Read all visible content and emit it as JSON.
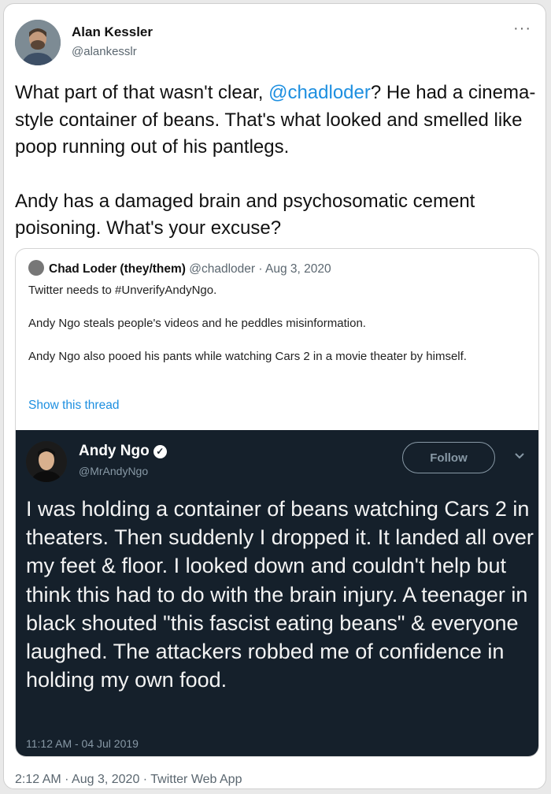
{
  "tweet": {
    "author_name": "Alan Kessler",
    "author_handle": "@alankesslr",
    "more_icon": "more-horizontal-icon",
    "text_part1": "What part of that wasn't clear, ",
    "mention": "@chadloder",
    "text_part2": "? He had a cinema-style container of beans. That's what looked and smelled like poop running out of his pantlegs.",
    "text_para2": "Andy has a damaged brain and psychosomatic cement poisoning. What's your excuse?",
    "footer": "2:12 AM · Aug 3, 2020 · Twitter Web App"
  },
  "quoted": {
    "author_name": "Chad Loder (they/them)",
    "meta": "@chadloder · Aug 3, 2020",
    "lines": [
      "Twitter needs to #UnverifyAndyNgo.",
      "Andy Ngo steals people's videos and he peddles misinformation.",
      "Andy Ngo also pooed his pants while watching Cars 2 in a movie theater by himself."
    ],
    "show_thread": "Show this thread"
  },
  "embedded": {
    "author_name": "Andy Ngo",
    "author_handle": "@MrAndyNgo",
    "follow_label": "Follow",
    "text": "I was holding a container of beans watching Cars 2 in theaters. Then suddenly I dropped it. It landed all over my feet & floor. I looked down and couldn't help but think this had to do with the brain injury. A teenager in black shouted \"this fascist eating beans\" & everyone laughed. The attackers robbed me of confidence in holding my own food.",
    "timestamp": "11:12 AM - 04 Jul 2019",
    "background": "#15202b"
  },
  "colors": {
    "link": "#1d8fe0",
    "muted": "#5b6770"
  }
}
